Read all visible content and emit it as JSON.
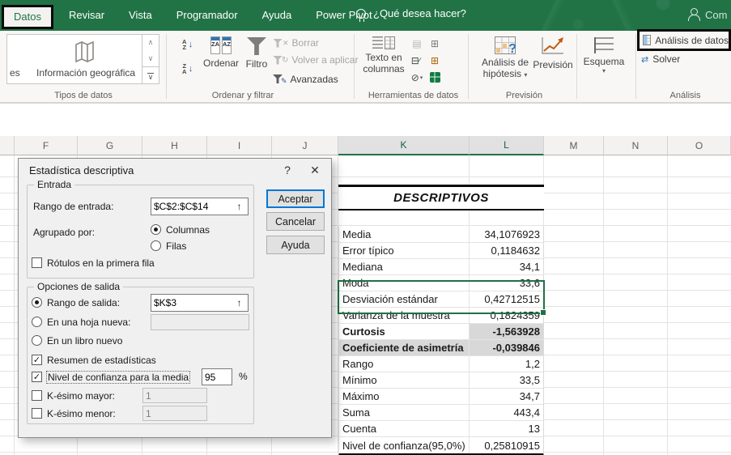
{
  "colors": {
    "excel_green": "#217346",
    "selection_border": "#1e7145",
    "focus_blue": "#0078d7",
    "selection_fill": "#d8d8d8"
  },
  "icons": {
    "help": "?",
    "close": "✕",
    "check": "✓",
    "caret": "▾",
    "up_arrow": "↑",
    "down_arrow": "↓",
    "chev_up": "∧",
    "chev_down": "∨",
    "letters_az": "AZ",
    "letters_za": "ZA",
    "percent": "%",
    "clear_x": "✕",
    "reapply": "↻",
    "pencil": "✎",
    "question": "?",
    "solver_arrows": "⇄"
  },
  "ribbon": {
    "tabs": [
      {
        "label": "Datos",
        "active": true
      },
      {
        "label": "Revisar",
        "active": false
      },
      {
        "label": "Vista",
        "active": false
      },
      {
        "label": "Programador",
        "active": false
      },
      {
        "label": "Ayuda",
        "active": false
      },
      {
        "label": "Power Pivot",
        "active": false
      }
    ],
    "tell_me": "¿Qué desea hacer?",
    "share_label": "Com",
    "data_types": {
      "group_label": "Tipos de datos",
      "gallery_partial_item": "es",
      "gallery_item": "Información geográfica"
    },
    "sort_filter": {
      "group_label": "Ordenar y filtrar",
      "sort": "Ordenar",
      "filter": "Filtro",
      "clear": "Borrar",
      "reapply": "Volver a aplicar",
      "advanced": "Avanzadas"
    },
    "data_tools": {
      "group_label": "Herramientas de datos",
      "text_to_columns_1": "Texto en",
      "text_to_columns_2": "columnas"
    },
    "forecast": {
      "group_label": "Previsión",
      "what_if_1": "Análisis de",
      "what_if_2": "hipótesis",
      "forecast_sheet": "Previsión"
    },
    "outline": {
      "button": "Esquema"
    },
    "analysis": {
      "group_label": "Análisis",
      "data_analysis": "Análisis de datos",
      "solver": "Solver"
    }
  },
  "sheet": {
    "columns": [
      {
        "letter": "F",
        "selected": false
      },
      {
        "letter": "G",
        "selected": false
      },
      {
        "letter": "H",
        "selected": false
      },
      {
        "letter": "I",
        "selected": false
      },
      {
        "letter": "J",
        "selected": false
      },
      {
        "letter": "K",
        "selected": true
      },
      {
        "letter": "L",
        "selected": true
      },
      {
        "letter": "M",
        "selected": false
      },
      {
        "letter": "N",
        "selected": false
      },
      {
        "letter": "O",
        "selected": false
      }
    ],
    "table": {
      "title": "DESCRIPTIVOS",
      "rows": [
        {
          "label": "Media",
          "value": "34,1076923"
        },
        {
          "label": "Error típico",
          "value": "0,1184632"
        },
        {
          "label": "Mediana",
          "value": "34,1"
        },
        {
          "label": "Moda",
          "value": "33,6"
        },
        {
          "label": "Desviación estándar",
          "value": "0,42712515"
        },
        {
          "label": "Varianza de la muestra",
          "value": "0,1824359"
        },
        {
          "label": "Curtosis",
          "value": "-1,563928",
          "bold": true,
          "cls": "sel-partial"
        },
        {
          "label": "Coeficiente de asimetría",
          "value": "-0,039846",
          "bold": true,
          "cls": "sel-full"
        },
        {
          "label": "Rango",
          "value": "1,2"
        },
        {
          "label": "Mínimo",
          "value": "33,5"
        },
        {
          "label": "Máximo",
          "value": "34,7"
        },
        {
          "label": "Suma",
          "value": "443,4"
        },
        {
          "label": "Cuenta",
          "value": "13"
        },
        {
          "label": "Nivel de confianza(95,0%)",
          "value": "0,25810915"
        }
      ]
    }
  },
  "dialog": {
    "title": "Estadística descriptiva",
    "input_group": {
      "label": "Entrada",
      "input_range_label": "Rango de entrada:",
      "input_range_value": "$C$2:$C$14",
      "grouped_by_label": "Agrupado por:",
      "columns_option": "Columnas",
      "rows_option": "Filas",
      "labels_first_row": "Rótulos en la primera fila"
    },
    "output_group": {
      "label": "Opciones de salida",
      "output_range_label": "Rango de salida:",
      "output_range_value": "$K$3",
      "new_sheet_label": "En una hoja nueva:",
      "new_book_label": "En un libro nuevo",
      "summary_label": "Resumen de estadísticas",
      "confidence_label": "Nivel de confianza para la media",
      "confidence_value": "95",
      "kth_largest_label": "K-ésimo mayor:",
      "kth_largest_value": "1",
      "kth_smallest_label": "K-ésimo menor:",
      "kth_smallest_value": "1"
    },
    "buttons": {
      "ok": "Aceptar",
      "cancel": "Cancelar",
      "help": "Ayuda"
    }
  }
}
